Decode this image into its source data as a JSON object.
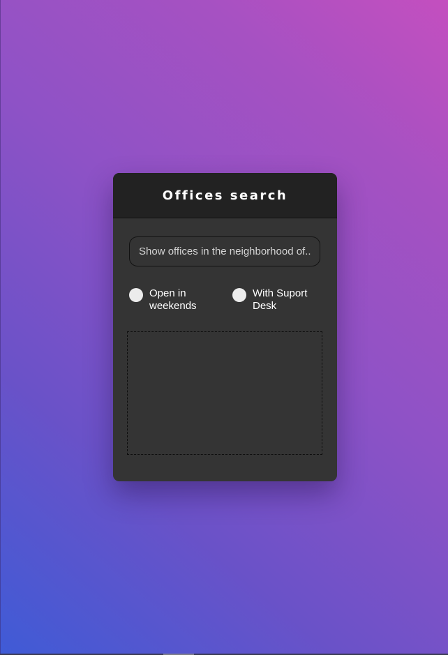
{
  "card": {
    "title": "Offices search"
  },
  "search": {
    "placeholder": "Show offices in the neighborhood of..",
    "value": ""
  },
  "filters": [
    {
      "label": "Open in weekends",
      "checked": false
    },
    {
      "label": "With Suport Desk",
      "checked": false
    }
  ],
  "colors": {
    "card_background": "#343434",
    "header_background": "#222222",
    "gradient_start": "#3f5bd6",
    "gradient_end": "#c44fbf"
  }
}
